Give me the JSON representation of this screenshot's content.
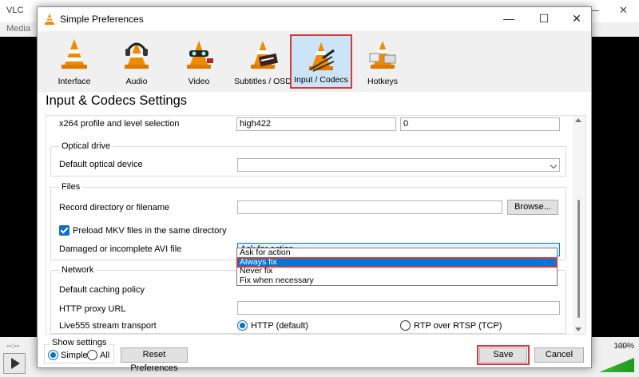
{
  "vlc": {
    "title": "VLC",
    "menu_media": "Media",
    "time_left": "--:--",
    "time_right": "--:--",
    "volume_pct": "100%"
  },
  "dialog": {
    "title": "Simple Preferences",
    "categories": [
      {
        "label": "Interface",
        "icon": "cone-interface-icon"
      },
      {
        "label": "Audio",
        "icon": "cone-headphones-icon"
      },
      {
        "label": "Video",
        "icon": "cone-video-icon"
      },
      {
        "label": "Subtitles / OSD",
        "icon": "cone-subtitles-icon"
      },
      {
        "label": "Input / Codecs",
        "icon": "cone-codecs-icon",
        "selected": true
      },
      {
        "label": "Hotkeys",
        "icon": "cone-hotkeys-icon"
      }
    ],
    "panel_title": "Input & Codecs Settings",
    "x264": {
      "label": "x264 profile and level selection",
      "profile": "high422",
      "level": "0"
    },
    "optical": {
      "group": "Optical drive",
      "label": "Default optical device",
      "value": ""
    },
    "files": {
      "group": "Files",
      "record_label": "Record directory or filename",
      "record_value": "",
      "browse": "Browse...",
      "preload_mkv": "Preload MKV files in the same directory",
      "damaged_label": "Damaged or incomplete AVI file",
      "damaged_value": "Ask for action",
      "damaged_options": [
        "Ask for action",
        "Always fix",
        "Never fix",
        "Fix when necessary"
      ],
      "highlighted_option": "Always fix"
    },
    "network": {
      "group": "Network",
      "caching_label": "Default caching policy",
      "proxy_label": "HTTP proxy URL",
      "proxy_value": "",
      "live555_label": "Live555 stream transport",
      "transport_http": "HTTP (default)",
      "transport_rtp": "RTP over RTSP (TCP)"
    },
    "show_settings": {
      "label": "Show settings",
      "simple": "Simple",
      "all": "All"
    },
    "reset": "Reset Preferences",
    "save": "Save",
    "cancel": "Cancel"
  },
  "colors": {
    "accent": "#0078d7",
    "highlight_border": "#d53a3a",
    "cone_orange": "#f08a00"
  }
}
